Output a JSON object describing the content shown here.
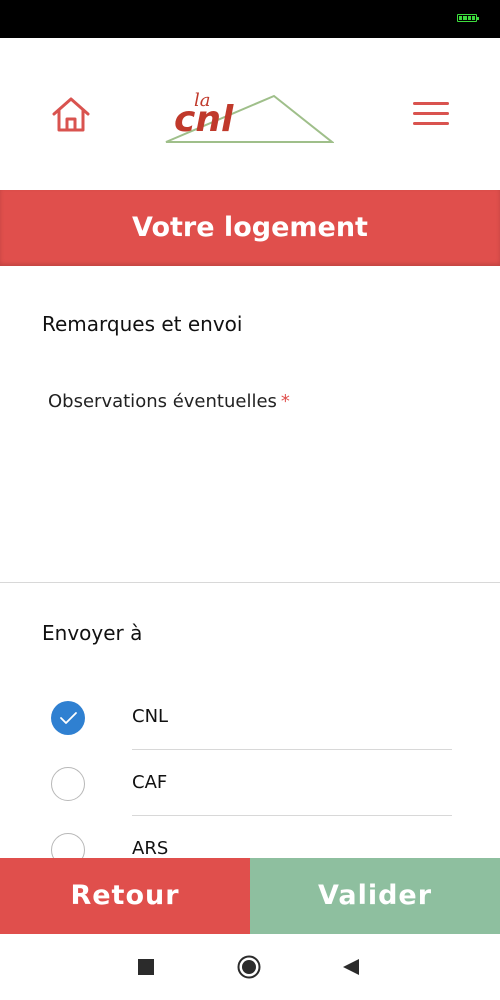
{
  "status_bar": {
    "battery_icon": "battery-icon"
  },
  "header": {
    "home_icon": "home-icon",
    "logo_text_small": "la",
    "logo_text": "cnl",
    "menu_icon": "hamburger-menu-icon"
  },
  "banner": {
    "title": "Votre logement"
  },
  "remarks": {
    "title": "Remarques et envoi",
    "observations_label": "Observations éventuelles",
    "required_mark": "*",
    "observations_value": ""
  },
  "send_to": {
    "title": "Envoyer à",
    "options": [
      {
        "label": "CNL",
        "checked": true
      },
      {
        "label": "CAF",
        "checked": false
      },
      {
        "label": "ARS",
        "checked": false
      }
    ]
  },
  "footer": {
    "back_label": "Retour",
    "submit_label": "Valider"
  },
  "colors": {
    "primary_red": "#e04f4c",
    "valider_green": "#8ebf9f",
    "check_blue": "#2f80d1"
  },
  "system_nav": {
    "recents_icon": "square-icon",
    "home_icon": "circle-home-icon",
    "back_icon": "triangle-back-icon"
  }
}
